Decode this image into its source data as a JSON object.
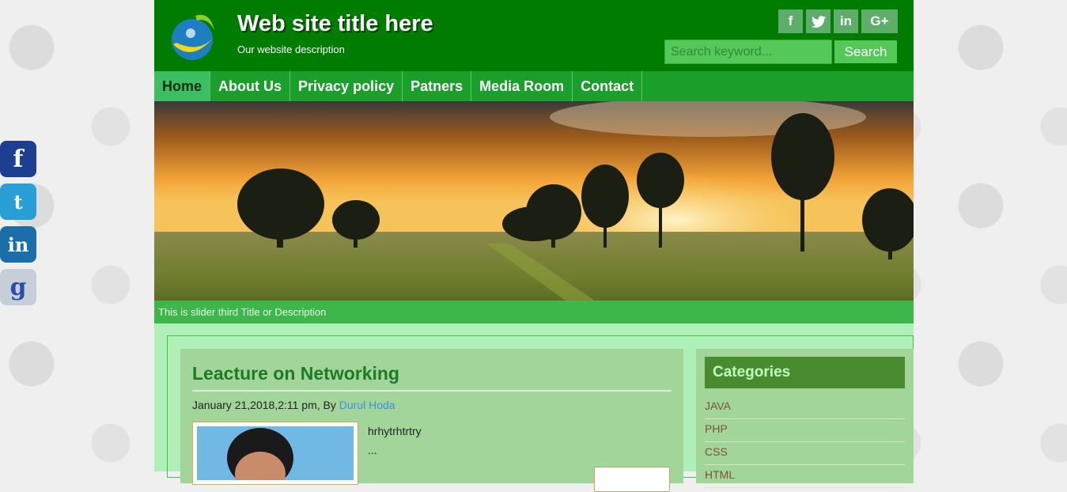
{
  "site": {
    "title": "Web site title here",
    "description": "Our website description"
  },
  "social_top": [
    {
      "icon": "facebook-icon",
      "glyph": "f"
    },
    {
      "icon": "twitter-icon",
      "glyph": "☷"
    },
    {
      "icon": "linkedin-icon",
      "glyph": "in"
    },
    {
      "icon": "google-plus-icon",
      "glyph": "G+"
    }
  ],
  "search": {
    "placeholder": "Search keyword...",
    "button_label": "Search"
  },
  "nav": {
    "items": [
      "Home",
      "About Us",
      "Privacy policy",
      "Patners",
      "Media Room",
      "Contact"
    ],
    "active": "Home"
  },
  "slider": {
    "caption": "This is slider third Title or Description"
  },
  "post": {
    "title": "Leacture on Networking",
    "date": "January 21,2018,2:11 pm, By",
    "author": "Durul Hoda",
    "excerpt": "hrhytrhtrtry",
    "ellipsis": "..."
  },
  "sidebar": {
    "heading": "Categories",
    "categories": [
      "JAVA",
      "PHP",
      "CSS",
      "HTML"
    ]
  },
  "floating_social": [
    "facebook-icon",
    "twitter-icon",
    "linkedin-icon",
    "google-icon"
  ],
  "colors": {
    "header_bg": "#007c00",
    "nav_bg": "#1a9f2b",
    "nav_active": "#3cbf63",
    "content_bg": "#aef0b8",
    "card_bg": "#a2d59a",
    "link": "#3a8fe6"
  }
}
